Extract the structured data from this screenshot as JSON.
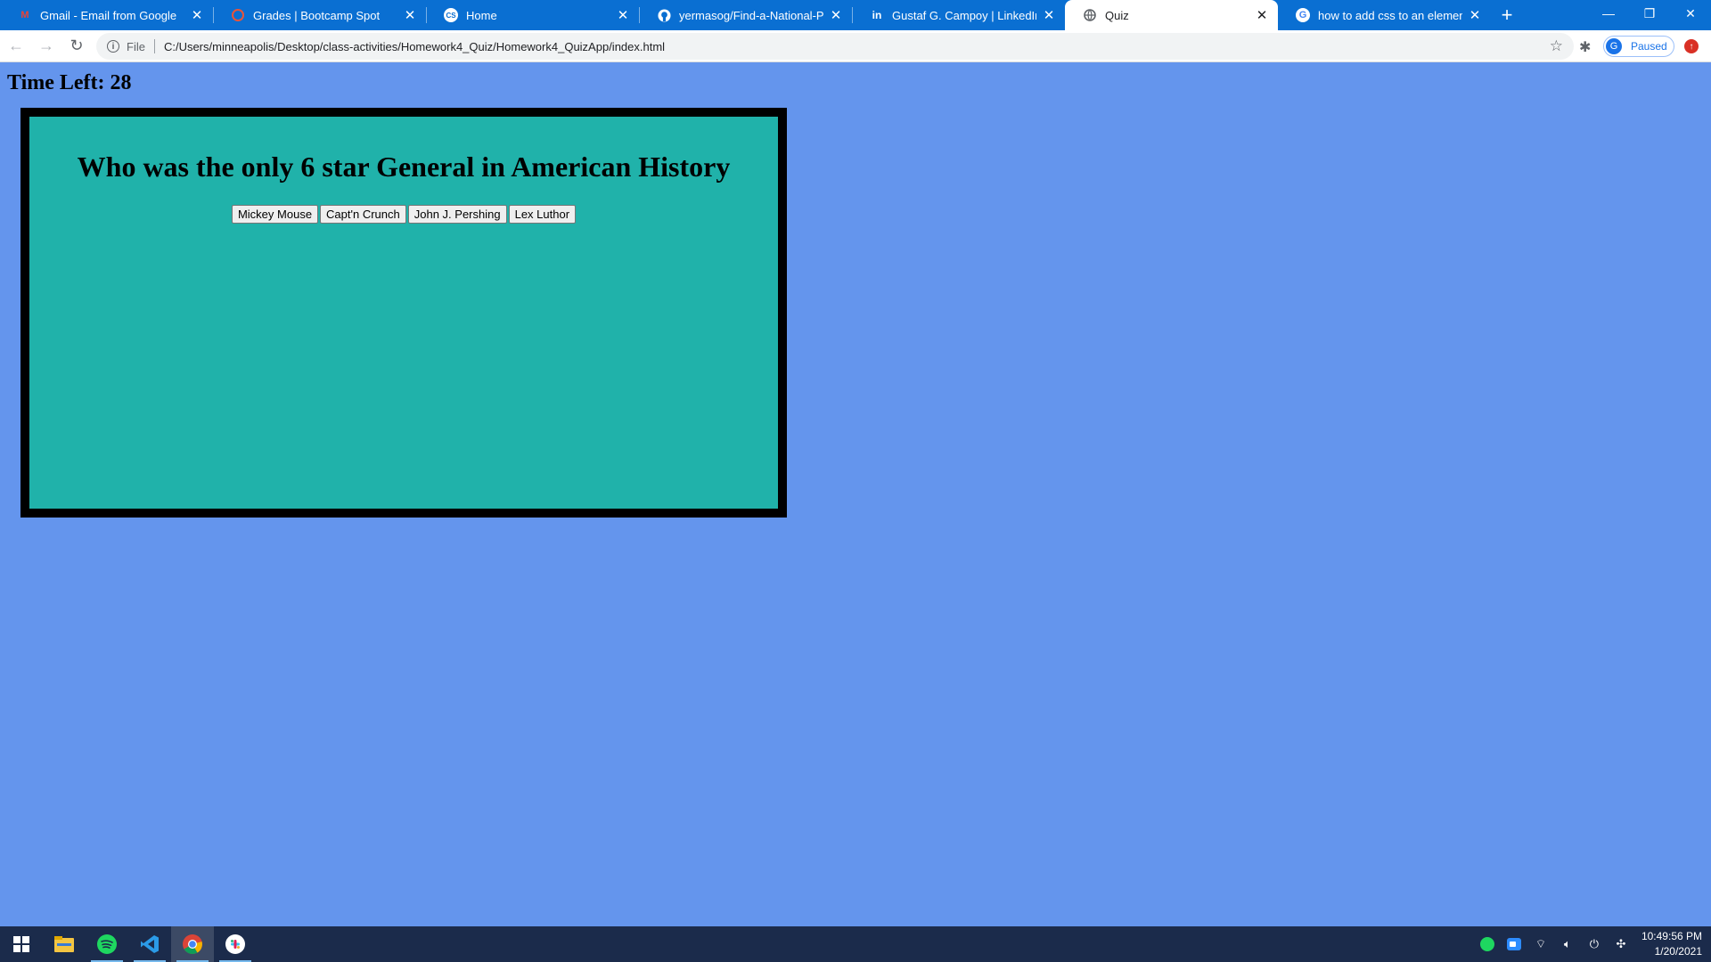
{
  "browser": {
    "tabs": [
      {
        "title": "Gmail - Email from Google",
        "icon": "gmail-icon",
        "active": false
      },
      {
        "title": "Grades | Bootcamp Spot",
        "icon": "bootcamp-icon",
        "active": false
      },
      {
        "title": "Home",
        "icon": "cs-icon",
        "active": false
      },
      {
        "title": "yermasog/Find-a-National-Park-",
        "icon": "github-icon",
        "active": false
      },
      {
        "title": "Gustaf G. Campoy | LinkedIn",
        "icon": "linkedin-icon",
        "active": false
      },
      {
        "title": "Quiz",
        "icon": "globe-icon",
        "active": true
      },
      {
        "title": "how to add css to an element in j",
        "icon": "google-icon",
        "active": false
      }
    ],
    "address": {
      "scheme_label": "File",
      "url": "C:/Users/minneapolis/Desktop/class-activities/Homework4_Quiz/Homework4_QuizApp/index.html"
    },
    "profile": {
      "initial": "G",
      "status": "Paused"
    }
  },
  "page": {
    "timer_text": "Time Left: 28",
    "question": "Who was the only 6 star General in American History",
    "answers": [
      "Mickey Mouse",
      "Capt'n Crunch",
      "John J. Pershing",
      "Lex Luthor"
    ]
  },
  "taskbar": {
    "apps": [
      "windows-start-icon",
      "file-explorer-icon",
      "spotify-icon",
      "vscode-icon",
      "chrome-icon",
      "slack-icon"
    ],
    "time": "10:49:56 PM",
    "date": "1/20/2021"
  },
  "colors": {
    "page_background": "#6495ed",
    "quiz_box_background": "#20b2aa",
    "quiz_box_border": "#000000",
    "tabstrip": "#0a6fd2"
  }
}
